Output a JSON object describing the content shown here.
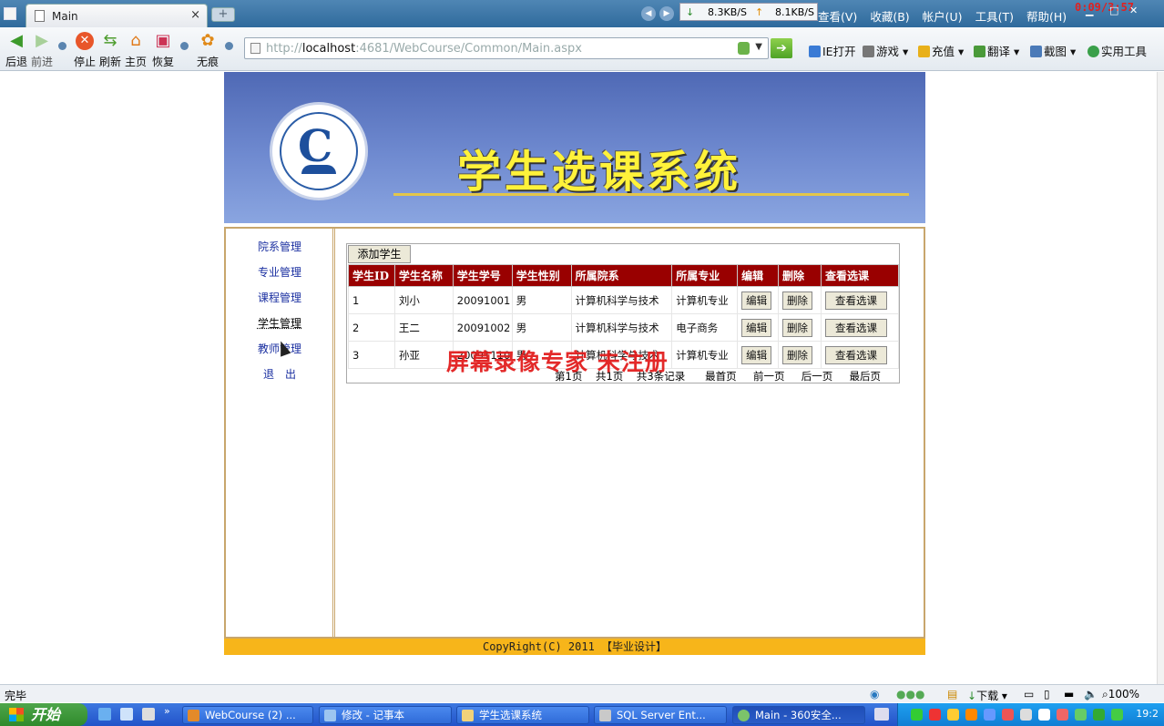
{
  "browser": {
    "tab_title": "Main",
    "tab_close": "×",
    "new_tab": "+",
    "speed_down": "8.3KB/S",
    "speed_up": "8.1KB/S",
    "menu": [
      "查看(V)",
      "收藏(B)",
      "帐户(U)",
      "工具(T)",
      "帮助(H)"
    ],
    "timer": "0:09/3:57",
    "toolbar": {
      "back": "后退",
      "forward": "前进",
      "stop": "停止",
      "refresh": "刷新",
      "home": "主页",
      "restore": "恢复",
      "incognito": "无痕"
    },
    "url_host": "localhost",
    "url_rest": ":4681/WebCourse/Common/Main.aspx",
    "url_prefix": "http://",
    "right_tools": [
      "IE打开",
      "游戏",
      "充值",
      "翻译",
      "截图",
      "实用工具"
    ]
  },
  "page": {
    "banner_title": "学生选课系统",
    "nav": [
      "院系管理",
      "专业管理",
      "课程管理",
      "学生管理",
      "教师管理",
      "退　出"
    ],
    "add_student": "添加学生",
    "columns": [
      "学生ID",
      "学生名称",
      "学生学号",
      "学生性别",
      "所属院系",
      "所属专业",
      "编辑",
      "删除",
      "查看选课"
    ],
    "rows": [
      {
        "id": "1",
        "name": "刘小",
        "number": "20091001",
        "gender": "男",
        "dept": "计算机科学与技术",
        "major": "计算机专业"
      },
      {
        "id": "2",
        "name": "王二",
        "number": "20091002",
        "gender": "男",
        "dept": "计算机科学与技术",
        "major": "电子商务"
      },
      {
        "id": "3",
        "name": "孙亚",
        "number": "20091110",
        "gender": "男",
        "dept": "计算机科学与技术",
        "major": "计算机专业"
      }
    ],
    "edit_label": "编辑",
    "delete_label": "删除",
    "view_label": "查看选课",
    "pager": {
      "current": "第1页",
      "total_pages": "共1页",
      "total_records": "共3条记录",
      "first": "最首页",
      "prev": "前一页",
      "next": "后一页",
      "last": "最后页"
    },
    "copyright": "CopyRight(C) 2011 【毕业设计】",
    "watermark": "屏幕录像专家 未注册"
  },
  "statusbar": {
    "status": "完毕",
    "download": "下载",
    "zoom": "100%"
  },
  "taskbar": {
    "start": "开始",
    "tasks": [
      "WebCourse (2) ...",
      "修改 - 记事本",
      "学生选课系统",
      "SQL Server Ent...",
      "Main - 360安全..."
    ],
    "clock": "19:2"
  },
  "colors": {
    "table_header": "#990000",
    "copyright_bar": "#f7b51a",
    "watermark": "#e21e1e",
    "banner": "#5f7ac4"
  }
}
